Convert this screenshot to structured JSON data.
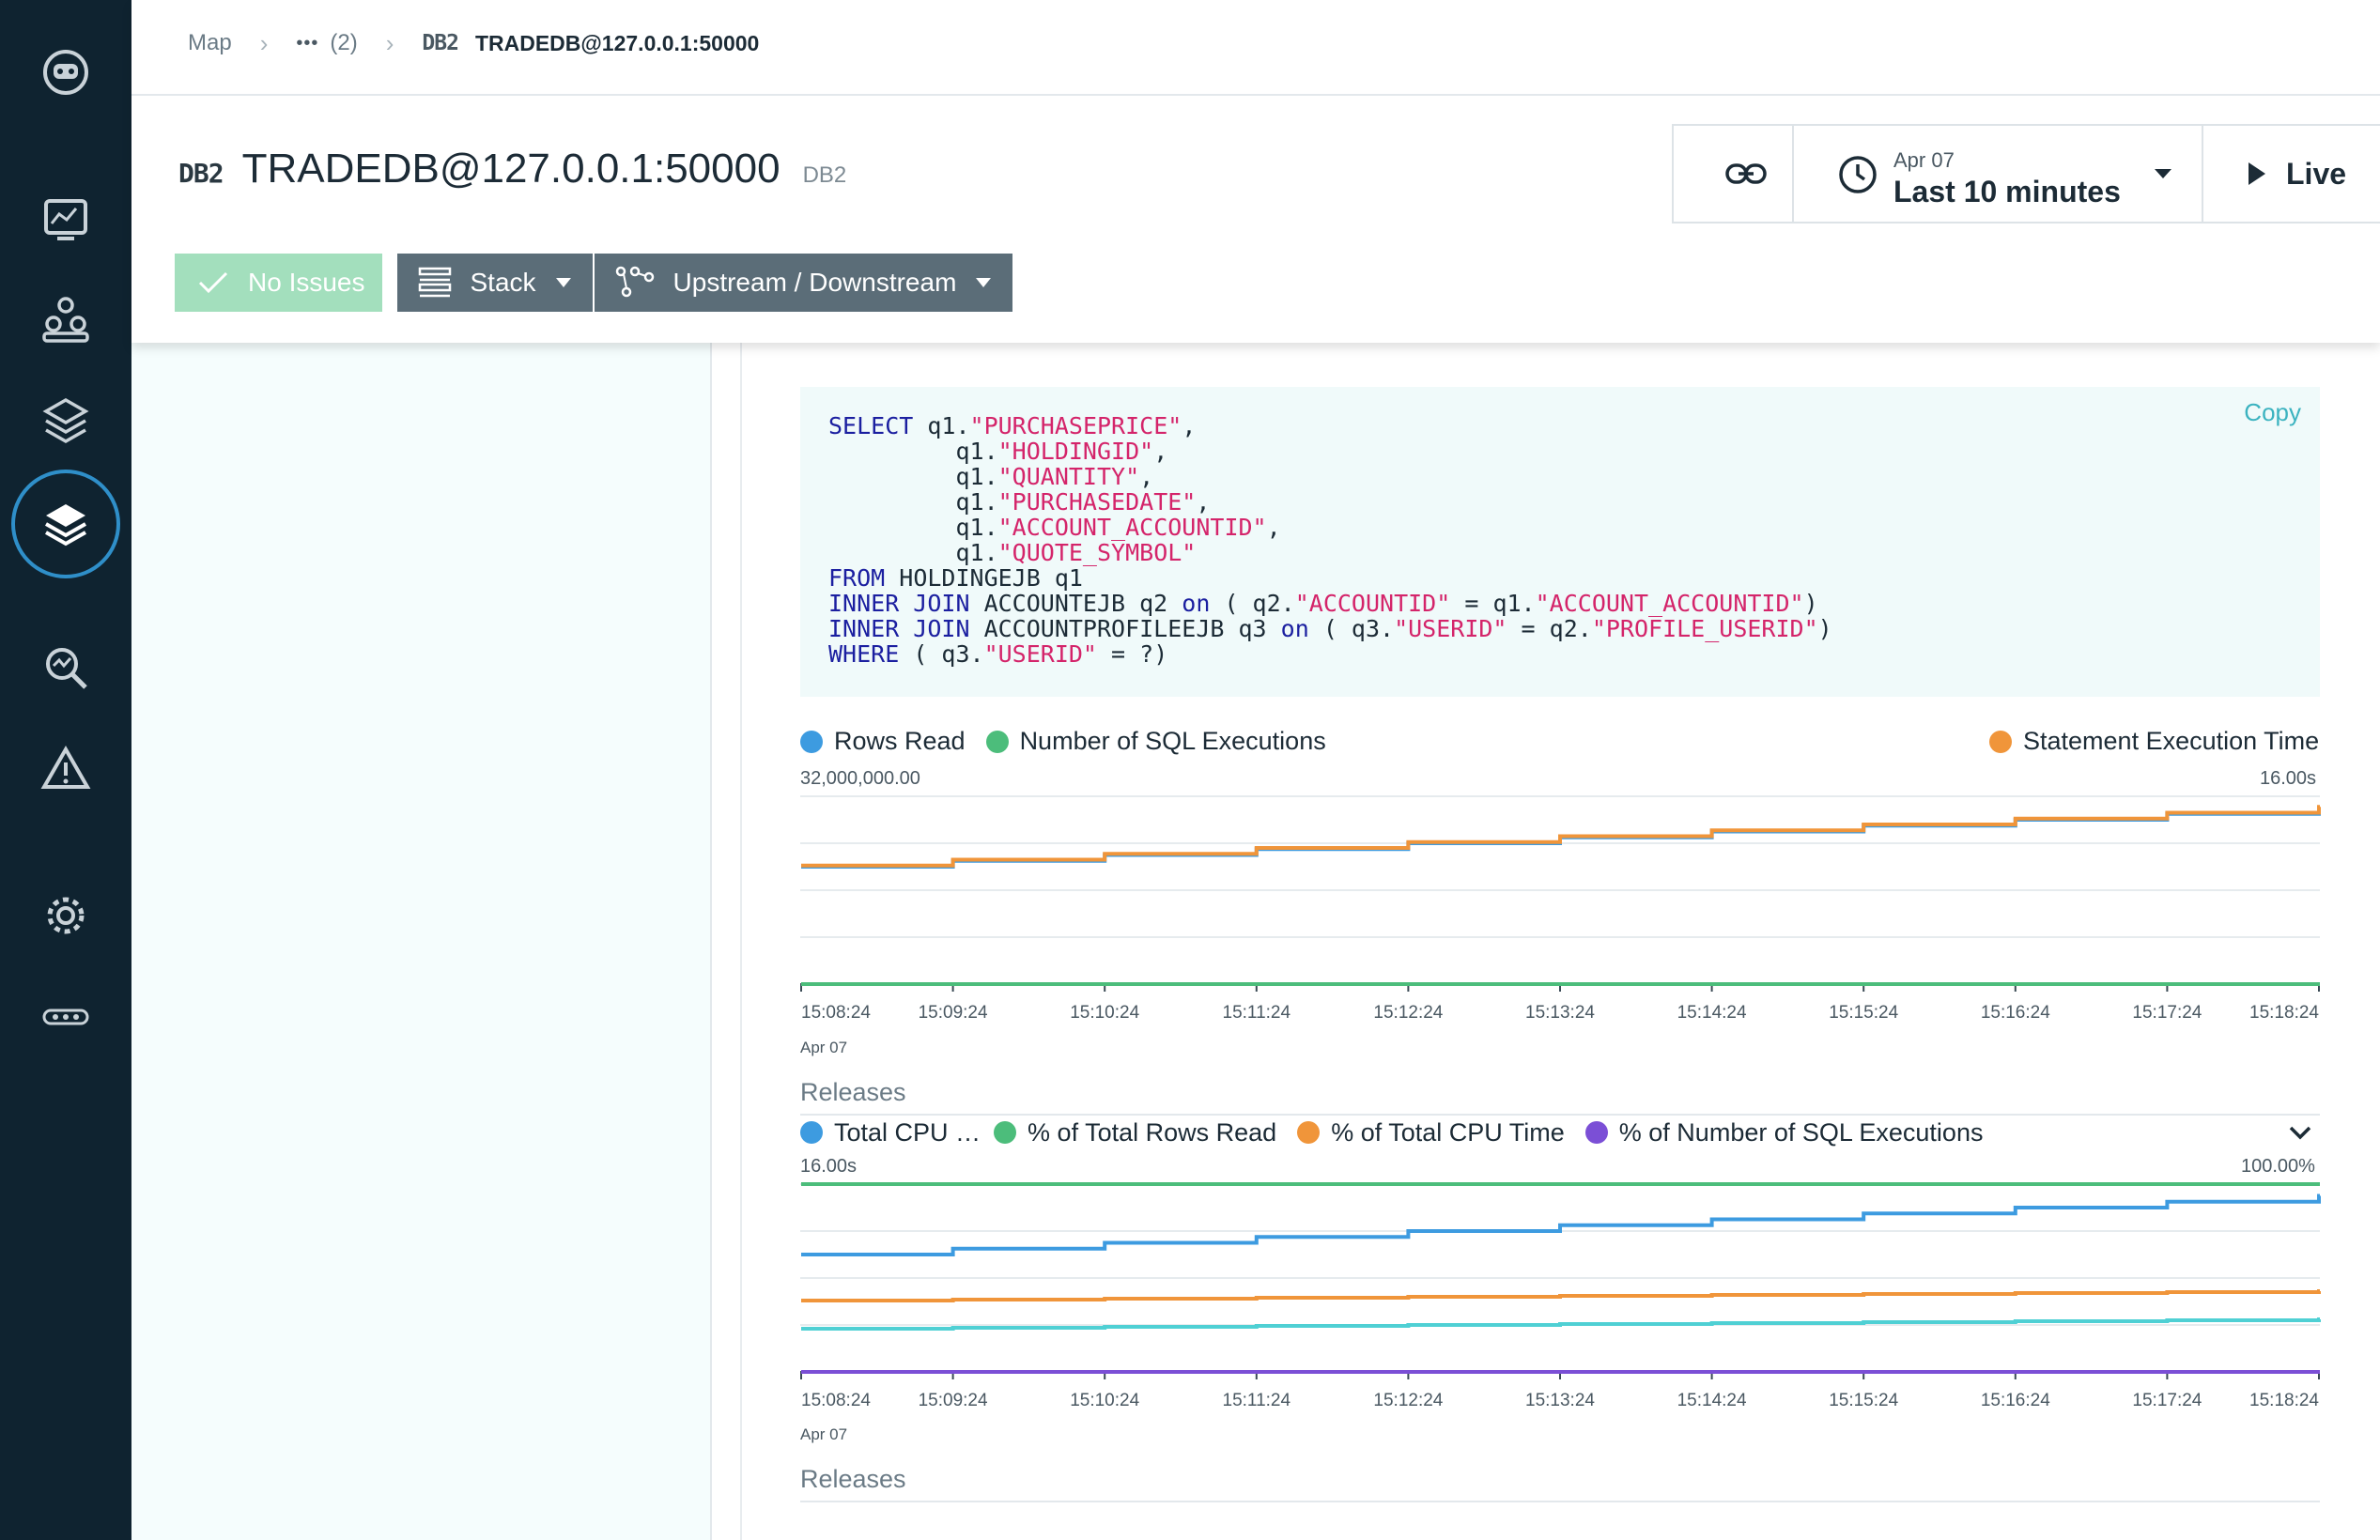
{
  "breadcrumb": {
    "map": "Map",
    "ellipsis": "•••",
    "count": "(2)",
    "db_type": "DB2",
    "current": "TRADEDB@127.0.0.1:50000"
  },
  "header": {
    "db_type": "DB2",
    "title": "TRADEDB@127.0.0.1:50000",
    "type_label": "DB2",
    "time_date": "Apr 07",
    "time_range": "Last 10 minutes",
    "live_label": "Live"
  },
  "toolbar": {
    "no_issues_label": "No Issues",
    "stack_label": "Stack",
    "upstream_downstream_label": "Upstream / Downstream"
  },
  "code": {
    "copy_label": "Copy",
    "lines": [
      [
        [
          "kw",
          "SELECT"
        ],
        [
          "t",
          " q1."
        ],
        [
          "str",
          "\"PURCHASEPRICE\""
        ],
        [
          "t",
          ","
        ]
      ],
      [
        [
          "t",
          "         q1."
        ],
        [
          "str",
          "\"HOLDINGID\""
        ],
        [
          "t",
          ","
        ]
      ],
      [
        [
          "t",
          "         q1."
        ],
        [
          "str",
          "\"QUANTITY\""
        ],
        [
          "t",
          ","
        ]
      ],
      [
        [
          "t",
          "         q1."
        ],
        [
          "str",
          "\"PURCHASEDATE\""
        ],
        [
          "t",
          ","
        ]
      ],
      [
        [
          "t",
          "         q1."
        ],
        [
          "str",
          "\"ACCOUNT_ACCOUNTID\""
        ],
        [
          "t",
          ","
        ]
      ],
      [
        [
          "t",
          "         q1."
        ],
        [
          "str",
          "\"QUOTE_SYMBOL\""
        ]
      ],
      [
        [
          "kw",
          "FROM"
        ],
        [
          "t",
          " HOLDINGEJB q1"
        ]
      ],
      [
        [
          "kw",
          "INNER JOIN"
        ],
        [
          "t",
          " ACCOUNTEJB q2 "
        ],
        [
          "kw",
          "on"
        ],
        [
          "t",
          " ( q2."
        ],
        [
          "str",
          "\"ACCOUNTID\""
        ],
        [
          "t",
          " = q1."
        ],
        [
          "str",
          "\"ACCOUNT_ACCOUNTID\""
        ],
        [
          "t",
          ")"
        ]
      ],
      [
        [
          "kw",
          "INNER JOIN"
        ],
        [
          "t",
          " ACCOUNTPROFILEEJB q3 "
        ],
        [
          "kw",
          "on"
        ],
        [
          "t",
          " ( q3."
        ],
        [
          "str",
          "\"USERID\""
        ],
        [
          "t",
          " = q2."
        ],
        [
          "str",
          "\"PROFILE_USERID\""
        ],
        [
          "t",
          ")"
        ]
      ],
      [
        [
          "kw",
          "WHERE"
        ],
        [
          "t",
          " ( q3."
        ],
        [
          "str",
          "\"USERID\""
        ],
        [
          "t",
          " = ?)"
        ]
      ]
    ]
  },
  "charts_text": {
    "chart1_left_axis_max": "32,000,000.00",
    "chart1_right_axis_max": "16.00s",
    "chart1_date": "Apr 07",
    "releases_label": "Releases",
    "chart2_left_axis_max": "16.00s",
    "chart2_right_axis_max": "100.00%",
    "chart2_date": "Apr 07"
  },
  "chart_data": [
    {
      "type": "line",
      "x": [
        "15:08:24",
        "15:09:24",
        "15:10:24",
        "15:11:24",
        "15:12:24",
        "15:13:24",
        "15:14:24",
        "15:15:24",
        "15:16:24",
        "15:17:24",
        "15:18:24"
      ],
      "y_left_max": 32000000,
      "y_right_max": 16,
      "series": [
        {
          "name": "Rows Read",
          "color": "#3d9be0",
          "axis": "left",
          "values": [
            20000000,
            21000000,
            22000000,
            23000000,
            24000000,
            25000000,
            26000000,
            27000000,
            28000000,
            29000000,
            30000000
          ]
        },
        {
          "name": "Number of SQL Executions",
          "color": "#4cbd7b",
          "axis": "left",
          "values": [
            0,
            0,
            0,
            0,
            0,
            0,
            0,
            0,
            0,
            0,
            0
          ]
        },
        {
          "name": "Statement Execution Time",
          "color": "#f0953a",
          "axis": "right",
          "values": [
            10.1,
            10.6,
            11.1,
            11.6,
            12.1,
            12.6,
            13.1,
            13.6,
            14.1,
            14.6,
            15.1
          ]
        }
      ]
    },
    {
      "type": "line",
      "x": [
        "15:08:24",
        "15:09:24",
        "15:10:24",
        "15:11:24",
        "15:12:24",
        "15:13:24",
        "15:14:24",
        "15:15:24",
        "15:16:24",
        "15:17:24",
        "15:18:24"
      ],
      "y_left_max": 16,
      "y_right_max": 100,
      "series": [
        {
          "name": "Total CPU …",
          "color": "#3d9be0",
          "axis": "left",
          "values": [
            10.0,
            10.5,
            11.0,
            11.5,
            12.0,
            12.5,
            13.0,
            13.5,
            14.0,
            14.5,
            15.0
          ]
        },
        {
          "name": "% of Total Rows Read",
          "color": "#4cbd7b",
          "axis": "right",
          "values": [
            100,
            100,
            100,
            100,
            100,
            100,
            100,
            100,
            100,
            100,
            100
          ]
        },
        {
          "name": "% of Total CPU Time",
          "color": "#f0953a",
          "axis": "right",
          "values": [
            38,
            38.5,
            39,
            39.5,
            40,
            40.5,
            41,
            41.5,
            42,
            42.5,
            43
          ]
        },
        {
          "name": "",
          "color": "#4fd0d4",
          "axis": "right",
          "values": [
            23,
            23.5,
            24,
            24.5,
            25,
            25.5,
            26,
            26.5,
            27,
            27.5,
            28
          ]
        },
        {
          "name": "% of Number of SQL Executions",
          "color": "#7b4fd6",
          "axis": "right",
          "values": [
            0,
            0,
            0,
            0,
            0,
            0,
            0,
            0,
            0,
            0,
            0
          ]
        }
      ]
    }
  ]
}
